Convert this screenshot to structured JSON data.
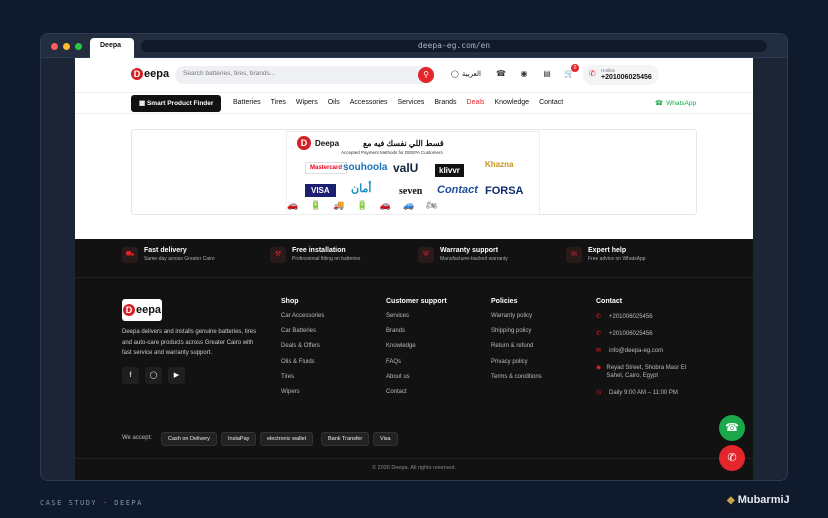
{
  "browser": {
    "tab_title": "Deepa",
    "url": "deepa-eg.com/en"
  },
  "header": {
    "logo_letter": "D",
    "logo_text": "eepa",
    "search_placeholder": "Search batteries, tires, brands...",
    "language": "العربية",
    "cart_count": "0",
    "hotline_label": "Hotline",
    "hotline_number": "+201006025456"
  },
  "nav": {
    "finder_label": "Smart Product Finder",
    "items": [
      "Batteries",
      "Tires",
      "Wipers",
      "Oils",
      "Accessories",
      "Services",
      "Brands",
      "Deals",
      "Knowledge",
      "Contact"
    ],
    "whatsapp": "WhatsApp"
  },
  "banner": {
    "headline_ar": "قسط اللي نفسك فيه مع",
    "brand": "Deepa",
    "subtitle": "Accepted Payment Methods for DEEPA Customers",
    "methods": [
      "Mastercard",
      "souhoola",
      "valU",
      "Khazna",
      "VISA",
      "أمان",
      "seven",
      "Contact",
      "FORSA",
      "klivvr"
    ]
  },
  "features": [
    {
      "title": "Fast delivery",
      "sub": "Same-day across Greater Cairo",
      "icon": "truck-icon"
    },
    {
      "title": "Free installation",
      "sub": "Professional fitting on batteries",
      "icon": "wrench-icon"
    },
    {
      "title": "Warranty support",
      "sub": "Manufacturer-backed warranty",
      "icon": "shield-icon"
    },
    {
      "title": "Expert help",
      "sub": "Free advice on WhatsApp",
      "icon": "chat-icon"
    }
  ],
  "footer": {
    "description": "Deepa delivers and installs genuine batteries, tires and auto-care products across Greater Cairo with fast service and warranty support.",
    "shop": {
      "title": "Shop",
      "items": [
        "Car Accessories",
        "Car Batteries",
        "Deals & Offers",
        "Oils & Fluids",
        "Tires",
        "Wipers"
      ]
    },
    "support": {
      "title": "Customer support",
      "items": [
        "Services",
        "Brands",
        "Knowledge",
        "FAQs",
        "About us",
        "Contact"
      ]
    },
    "policies": {
      "title": "Policies",
      "items": [
        "Warranty policy",
        "Shipping policy",
        "Return & refund",
        "Privacy policy",
        "Terms & conditions"
      ]
    },
    "contact": {
      "title": "Contact",
      "phone1": "+201006025456",
      "phone2": "+201006025456",
      "email": "info@deepa-eg.com",
      "address": "Reyad Street, Shobra Masr El Sahel, Cairo, Egypt",
      "hours": "Daily 9:00 AM – 11:00 PM"
    },
    "accept_label": "We accept:",
    "payments": [
      "Cash on Delivery",
      "InstaPay",
      "electronic wallet",
      "Bank Transfer",
      "Visa"
    ],
    "copyright": "© 2026 Deepa. All rights reserved."
  },
  "caption": {
    "case": "CASE STUDY · DEEPA",
    "brand": "MubarmiJ"
  },
  "colors": {
    "accent": "#e3262b",
    "whatsapp": "#1aa84a",
    "footer_bg": "#121212",
    "outer_bg": "#0f1a2c"
  }
}
